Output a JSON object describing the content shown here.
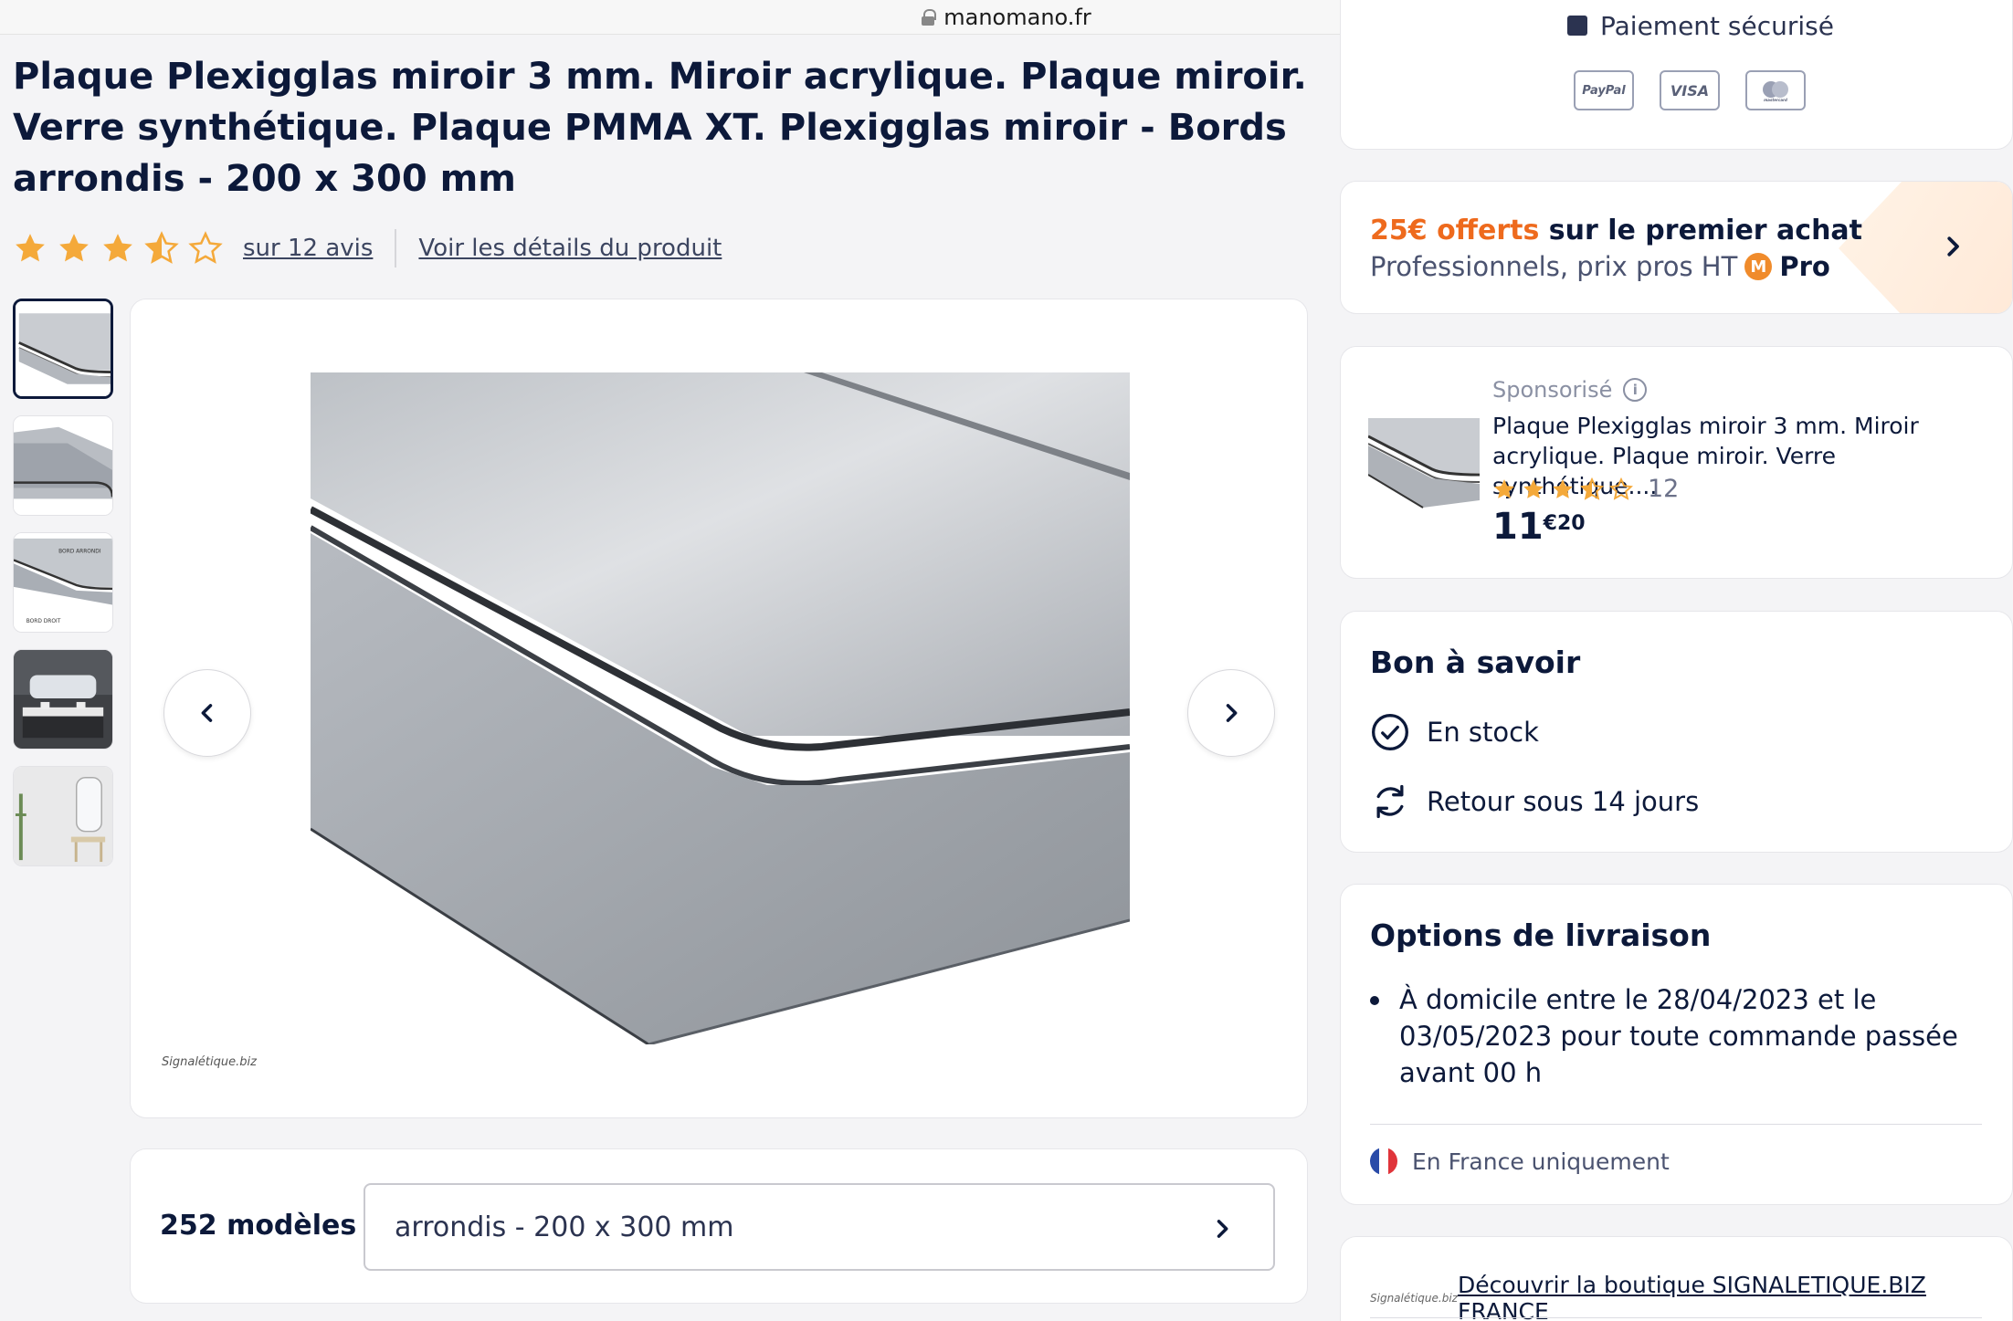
{
  "browser": {
    "url": "manomano.fr"
  },
  "product": {
    "title": "Plaque Plexigglas miroir 3 mm. Miroir acrylique. Plaque miroir. Verre synthétique. Plaque PMMA XT. Plexigglas miroir - Bords arrondis - 200 x 300 mm",
    "rating": 3.5,
    "rating_max": 5,
    "reviews_link": "sur 12 avis",
    "details_link": "Voir les détails du produit"
  },
  "gallery": {
    "thumbnail_count": 5,
    "active_index": 0,
    "watermark": "Signalétique.biz"
  },
  "models": {
    "count_label": "252 modèles",
    "selected": "arrondis - 200 x 300 mm"
  },
  "payment": {
    "label": "Paiement sécurisé",
    "methods": [
      "PayPal",
      "VISA",
      "mastercard"
    ]
  },
  "pro_offer": {
    "highlight": "25€ offerts",
    "rest": " sur le premier achat",
    "subtitle": "Professionnels, prix pros HT",
    "badge_letter": "M",
    "badge_word": "Pro"
  },
  "sponsored": {
    "label": "Sponsorisé",
    "title": "Plaque Plexigglas miroir 3 mm. Miroir acrylique. Plaque miroir. Verre synthétique....",
    "rating": 3.5,
    "count": "12",
    "price_int": "11",
    "price_cents": "€20"
  },
  "good_to_know": {
    "heading": "Bon à savoir",
    "stock": "En stock",
    "returns": "Retour sous 14 jours"
  },
  "shipping": {
    "heading": "Options de livraison",
    "item": "À domicile entre le 28/04/2023 et le 03/05/2023 pour toute commande passée avant 00 h",
    "country": "En France uniquement"
  },
  "shop": {
    "logo": "Signalétique.biz",
    "link": "Découvrir la boutique SIGNALETIQUE.BIZ FRANCE"
  },
  "colors": {
    "navy": "#0c193a",
    "star": "#f4a93a",
    "orange": "#ee6a1d"
  }
}
